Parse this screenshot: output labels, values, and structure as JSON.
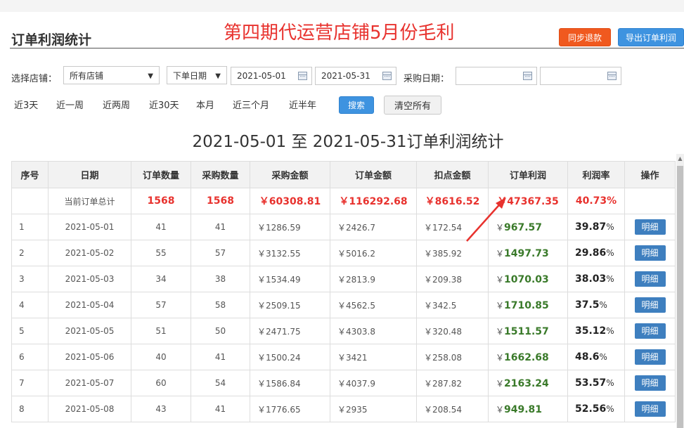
{
  "page_title": "订单利润统计",
  "banner_text": "第四期代运营店铺5月份毛利",
  "actions": {
    "sync_refund": "同步退款",
    "export_profit": "导出订单利润"
  },
  "filters": {
    "shop_label": "选择店铺：",
    "shop_value": "所有店铺",
    "date_type_value": "下单日期",
    "date_from": "2021-05-01",
    "date_to": "2021-05-31",
    "purchase_date_label": "采购日期："
  },
  "quick_ranges": [
    "近3天",
    "近一周",
    "近两周",
    "近30天",
    "本月",
    "近三个月",
    "近半年"
  ],
  "search_button": "搜索",
  "clear_button": "清空所有",
  "report_title": "2021-05-01 至 2021-05-31订单利润统计",
  "table": {
    "headers": [
      "序号",
      "日期",
      "订单数量",
      "采购数量",
      "采购金额",
      "订单金额",
      "扣点金额",
      "订单利润",
      "利润率",
      "操作"
    ],
    "total": {
      "label": "当前订单总计",
      "orders": "1568",
      "purchases": "1568",
      "purchase_amount": "￥60308.81",
      "order_amount": "￥116292.68",
      "deduction": "￥8616.52",
      "profit": "￥47367.35",
      "rate": "40.73%"
    },
    "detail_label": "明细",
    "rows": [
      {
        "no": "1",
        "date": "2021-05-01",
        "orders": "41",
        "purchases": "41",
        "purchase_amount": "￥1286.59",
        "order_amount": "￥2426.7",
        "deduction": "￥172.54",
        "profit_sym": "￥",
        "profit": "967.57",
        "rate": "39.87",
        "pct": "%"
      },
      {
        "no": "2",
        "date": "2021-05-02",
        "orders": "55",
        "purchases": "57",
        "purchase_amount": "￥3132.55",
        "order_amount": "￥5016.2",
        "deduction": "￥385.92",
        "profit_sym": "￥",
        "profit": "1497.73",
        "rate": "29.86",
        "pct": "%"
      },
      {
        "no": "3",
        "date": "2021-05-03",
        "orders": "34",
        "purchases": "38",
        "purchase_amount": "￥1534.49",
        "order_amount": "￥2813.9",
        "deduction": "￥209.38",
        "profit_sym": "￥",
        "profit": "1070.03",
        "rate": "38.03",
        "pct": "%"
      },
      {
        "no": "4",
        "date": "2021-05-04",
        "orders": "57",
        "purchases": "58",
        "purchase_amount": "￥2509.15",
        "order_amount": "￥4562.5",
        "deduction": "￥342.5",
        "profit_sym": "￥",
        "profit": "1710.85",
        "rate": "37.5",
        "pct": "%"
      },
      {
        "no": "5",
        "date": "2021-05-05",
        "orders": "51",
        "purchases": "50",
        "purchase_amount": "￥2471.75",
        "order_amount": "￥4303.8",
        "deduction": "￥320.48",
        "profit_sym": "￥",
        "profit": "1511.57",
        "rate": "35.12",
        "pct": "%"
      },
      {
        "no": "6",
        "date": "2021-05-06",
        "orders": "40",
        "purchases": "41",
        "purchase_amount": "￥1500.24",
        "order_amount": "￥3421",
        "deduction": "￥258.08",
        "profit_sym": "￥",
        "profit": "1662.68",
        "rate": "48.6",
        "pct": "%"
      },
      {
        "no": "7",
        "date": "2021-05-07",
        "orders": "60",
        "purchases": "54",
        "purchase_amount": "￥1586.84",
        "order_amount": "￥4037.9",
        "deduction": "￥287.82",
        "profit_sym": "￥",
        "profit": "2163.24",
        "rate": "53.57",
        "pct": "%"
      },
      {
        "no": "8",
        "date": "2021-05-08",
        "orders": "43",
        "purchases": "41",
        "purchase_amount": "￥1776.65",
        "order_amount": "￥2935",
        "deduction": "￥208.54",
        "profit_sym": "￥",
        "profit": "949.81",
        "rate": "52.56",
        "pct": "%"
      }
    ]
  },
  "colors": {
    "banner": "#e8322e",
    "total": "#e8322e",
    "profit": "#3a7a2a",
    "arrow": "#e8322e",
    "detail_button": "#3e7fbf"
  }
}
